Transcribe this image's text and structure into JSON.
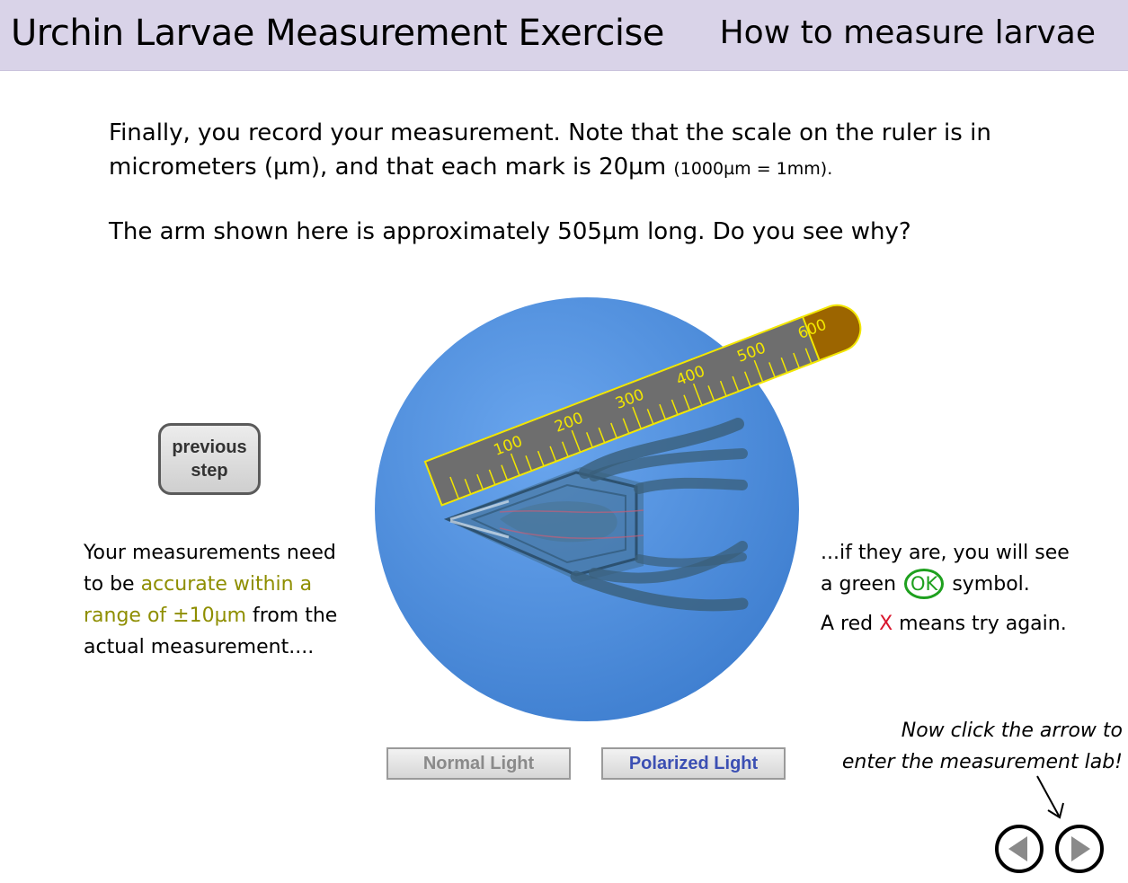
{
  "header": {
    "app_title": "Urchin Larvae Measurement Exercise",
    "section_title": "How to measure larvae",
    "background": "#d9d3e8"
  },
  "intro": {
    "line1": "Finally, you record your measurement.  Note that the scale on the ruler is in",
    "line2_main": "micrometers (µm), and that each mark is 20µm ",
    "line2_small": "(1000µm = 1mm).",
    "line3": "The arm shown here is approximately 505µm long.  Do you see why?"
  },
  "buttons": {
    "previous_step_line1": "previous",
    "previous_step_line2": "step",
    "normal_light": "Normal Light",
    "polarized_light": "Polarized Light"
  },
  "left_note": {
    "p1": "Your measurements need",
    "p2_a": "to be ",
    "p2_hl": "accurate within a",
    "p3_hl": "range of ±10µm",
    "p3_b": " from the",
    "p4": "actual measurement...."
  },
  "right_note": {
    "l1": "...if they are, you will see",
    "l2_a": "a green ",
    "ok_symbol": "OK",
    "l2_b": " symbol.",
    "l3_a": "A red ",
    "red_x": "X",
    "l3_b": " means try again."
  },
  "cta": {
    "line1": "Now click the arrow to",
    "line2": "enter the measurement lab!"
  },
  "ruler": {
    "labels": [
      "100",
      "200",
      "300",
      "400",
      "500",
      "600"
    ],
    "color_body": "#6e6e6e",
    "color_border": "#f2e600",
    "color_cap": "#9c6500"
  },
  "nav": {
    "back_icon": "triangle-left-icon",
    "next_icon": "triangle-right-icon"
  }
}
